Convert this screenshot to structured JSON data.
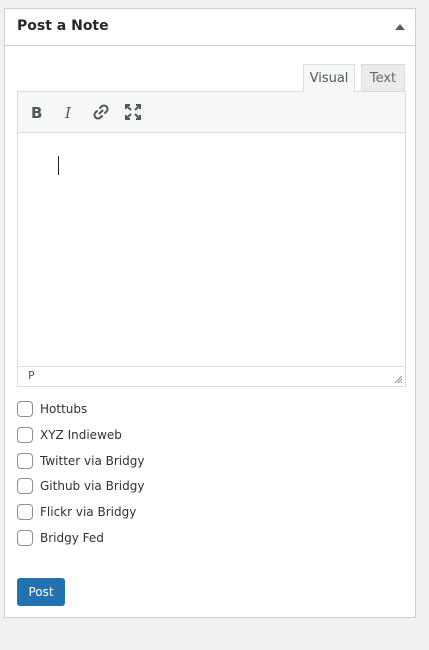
{
  "widget": {
    "title": "Post a Note"
  },
  "editor": {
    "tabs": [
      {
        "label": "Visual"
      },
      {
        "label": "Text"
      }
    ],
    "status_path": "P"
  },
  "options": [
    {
      "label": "Hottubs"
    },
    {
      "label": "XYZ Indieweb"
    },
    {
      "label": "Twitter via Bridgy"
    },
    {
      "label": "Github via Bridgy"
    },
    {
      "label": "Flickr via Bridgy"
    },
    {
      "label": "Bridgy Fed"
    }
  ],
  "actions": {
    "post_label": "Post"
  },
  "colors": {
    "primary": "#2271b1",
    "border": "#ccd0d4",
    "toolbar_bg": "#f6f7f7"
  }
}
